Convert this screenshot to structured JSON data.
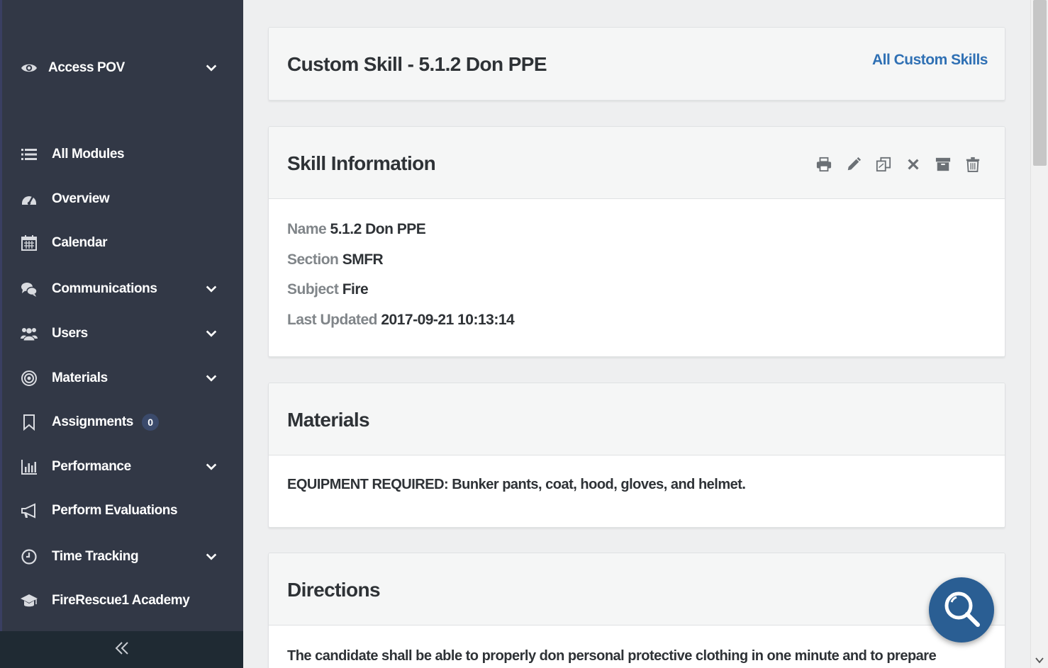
{
  "sidebar": {
    "pov": {
      "label": "Access POV",
      "icon": "eye-icon"
    },
    "items": [
      {
        "label": "All Modules",
        "icon": "list-icon",
        "has_chevron": false
      },
      {
        "label": "Overview",
        "icon": "dashboard-icon",
        "has_chevron": false
      },
      {
        "label": "Calendar",
        "icon": "calendar-icon",
        "has_chevron": false
      },
      {
        "label": "Communications",
        "icon": "chat-icon",
        "has_chevron": true
      },
      {
        "label": "Users",
        "icon": "users-icon",
        "has_chevron": true
      },
      {
        "label": "Materials",
        "icon": "target-icon",
        "has_chevron": true
      },
      {
        "label": "Assignments",
        "icon": "bookmark-icon",
        "has_chevron": false,
        "badge": "0"
      },
      {
        "label": "Performance",
        "icon": "bar-chart-icon",
        "has_chevron": true
      },
      {
        "label": "Perform Evaluations",
        "icon": "megaphone-icon",
        "has_chevron": false
      },
      {
        "label": "Time Tracking",
        "icon": "clock-icon",
        "has_chevron": true
      },
      {
        "label": "FireRescue1 Academy",
        "icon": "graduation-cap-icon",
        "has_chevron": false
      }
    ],
    "collapse_icon": "double-chevron-left-icon"
  },
  "header_card": {
    "title": "Custom Skill - 5.1.2 Don PPE",
    "link": "All Custom Skills"
  },
  "skill_info": {
    "title": "Skill Information",
    "toolbar": [
      "print-icon",
      "pencil-icon",
      "copy-icon",
      "close-icon",
      "archive-icon",
      "trash-icon"
    ],
    "fields": [
      {
        "key": "Name",
        "value": "5.1.2 Don PPE"
      },
      {
        "key": "Section",
        "value": "SMFR"
      },
      {
        "key": "Subject",
        "value": "Fire"
      },
      {
        "key": "Last Updated",
        "value": "2017-09-21 10:13:14"
      }
    ]
  },
  "materials": {
    "title": "Materials",
    "text": "EQUIPMENT REQUIRED: Bunker pants, coat, hood, gloves, and helmet."
  },
  "directions": {
    "title": "Directions",
    "text": "The candidate shall be able to properly don personal protective clothing in one minute and to prepare"
  },
  "fab": {
    "icon": "search-icon"
  },
  "colors": {
    "sidebar_bg": "#323846",
    "accent_link": "#2f70b4",
    "fab_bg": "#2a5e93"
  }
}
